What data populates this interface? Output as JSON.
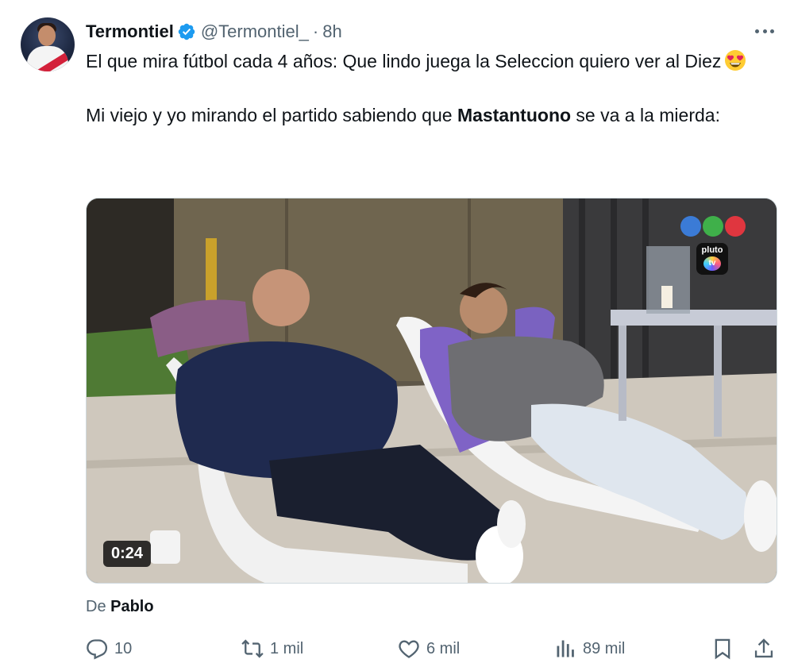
{
  "author": {
    "display_name": "Termontiel",
    "handle": "@Termontiel_",
    "separator": "·",
    "time": "8h"
  },
  "tweet": {
    "line1": "El que mira fútbol cada 4 años: Que lindo juega la Seleccion quiero ver al Diez",
    "line2_before": "Mi viejo y yo mirando el partido sabiendo que ",
    "line2_bold": "Mastantuono",
    "line2_after": " se va a la mierda:"
  },
  "media": {
    "duration": "0:24",
    "pluto_label": "pluto",
    "pluto_tv": "tv"
  },
  "attribution": {
    "prefix": "De ",
    "name": "Pablo"
  },
  "actions": {
    "replies": "10",
    "reposts": "1 mil",
    "likes": "6 mil",
    "views": "89 mil"
  },
  "colors": {
    "verified": "#1d9bf0",
    "secondary_text": "#536471",
    "primary_text": "#0f1419"
  },
  "icons": [
    "verified-icon",
    "more-icon",
    "heart-eyes-emoji",
    "reply-icon",
    "repost-icon",
    "like-icon",
    "views-icon",
    "bookmark-icon",
    "share-icon"
  ]
}
